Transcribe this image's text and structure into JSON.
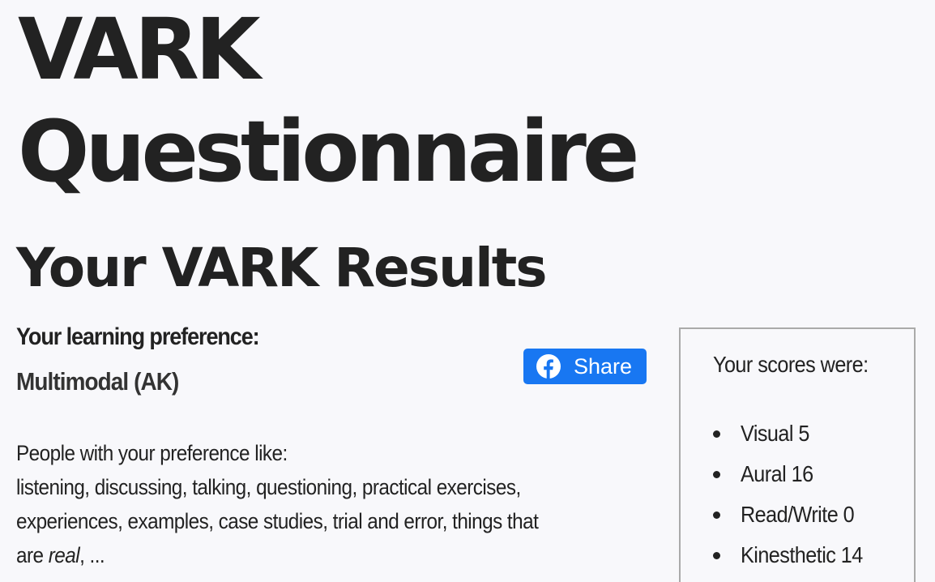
{
  "header": {
    "title": "VARK Questionnaire",
    "subtitle": "Your VARK Results"
  },
  "preference": {
    "label": "Your learning preference:",
    "value": "Multimodal (AK)"
  },
  "share": {
    "label": "Share",
    "icon": "facebook-icon",
    "color": "#1877f2"
  },
  "description": {
    "intro": "People with your preference like:",
    "line1": "listening, discussing, talking, questioning, practical exercises,",
    "line2": "experiences, examples, case studies, trial and error, things that",
    "line3_prefix": "are ",
    "line3_emphasis": "real",
    "line3_suffix": ", ..."
  },
  "scores": {
    "title": "Your scores were:",
    "items": [
      {
        "label": "Visual 5"
      },
      {
        "label": "Aural 16"
      },
      {
        "label": "Read/Write 0"
      },
      {
        "label": "Kinesthetic 14"
      }
    ]
  }
}
